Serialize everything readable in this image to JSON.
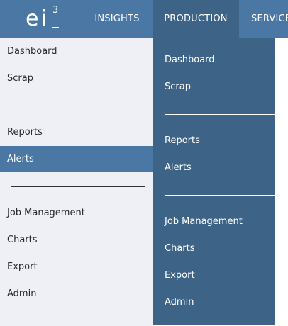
{
  "brand": {
    "logo_letter_e": "e",
    "logo_letter_i": "i",
    "logo_superscript": "3"
  },
  "nav": {
    "items": [
      {
        "label": "INSIGHTS"
      },
      {
        "label": "PRODUCTION"
      },
      {
        "label": "SERVICE"
      }
    ]
  },
  "sidebar": {
    "items": [
      {
        "label": "Dashboard"
      },
      {
        "label": "Scrap"
      },
      {
        "label": "Reports"
      },
      {
        "label": "Alerts"
      },
      {
        "label": "Job Management"
      },
      {
        "label": "Charts"
      },
      {
        "label": "Export"
      },
      {
        "label": "Admin"
      }
    ],
    "active": "Alerts"
  },
  "dropdown": {
    "items": [
      {
        "label": "Dashboard"
      },
      {
        "label": "Scrap"
      },
      {
        "label": "Reports"
      },
      {
        "label": "Alerts"
      },
      {
        "label": "Job Management"
      },
      {
        "label": "Charts"
      },
      {
        "label": "Export"
      },
      {
        "label": "Admin"
      }
    ]
  },
  "colors": {
    "topbar": "#4a77a3",
    "nav_active": "#3d6386",
    "sidebar_bg": "#eef0f6",
    "sidebar_active": "#4a77a3",
    "dropdown_bg": "#3d6386"
  }
}
